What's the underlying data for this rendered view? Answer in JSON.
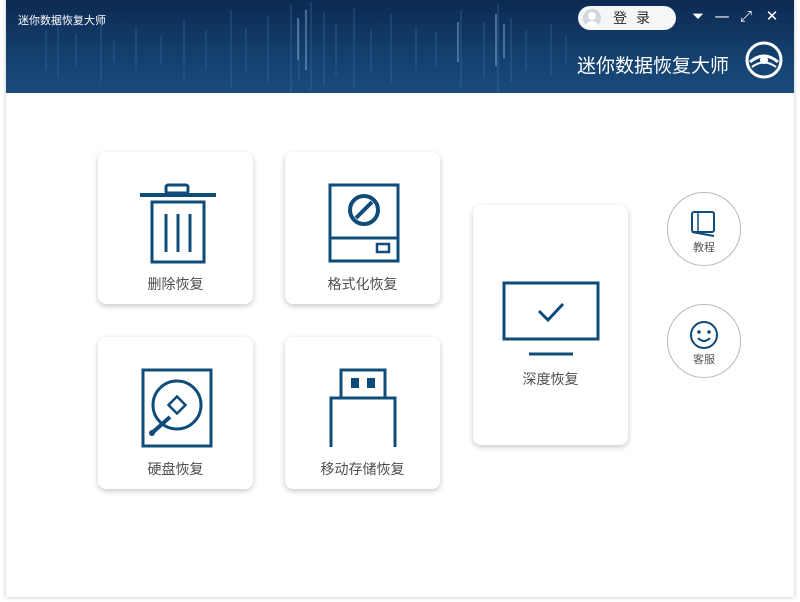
{
  "window": {
    "title": "迷你数据恢复大师"
  },
  "login": {
    "label": "登录"
  },
  "brand": {
    "name": "迷你数据恢复大师"
  },
  "window_controls": [
    {
      "name": "menu-icon",
      "glyph": "⏷"
    },
    {
      "name": "minimize-icon",
      "glyph": "—"
    },
    {
      "name": "maximize-icon",
      "glyph": "⤢"
    },
    {
      "name": "close-icon",
      "glyph": "✕"
    }
  ],
  "cards": {
    "delete": {
      "label": "删除恢复"
    },
    "format": {
      "label": "格式化恢复"
    },
    "disk": {
      "label": "硬盘恢复"
    },
    "removable": {
      "label": "移动存储恢复"
    },
    "deep": {
      "label": "深度恢复"
    }
  },
  "side": {
    "tutorial": {
      "label": "教程"
    },
    "service": {
      "label": "客服"
    }
  },
  "colors": {
    "header": "#14406e",
    "icon": "#0f4c7a",
    "card_bg": "#ffffff"
  }
}
